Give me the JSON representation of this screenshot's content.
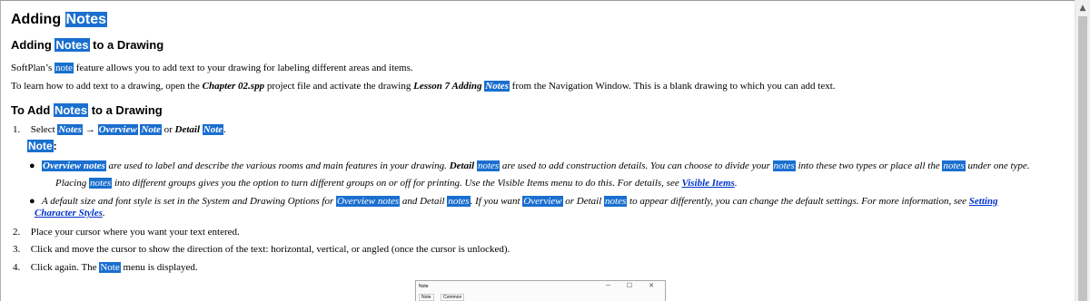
{
  "page": {
    "title_a": "Adding",
    "title_b": "Notes",
    "h2_a": "Adding",
    "h2_b": "Notes",
    "h2_c": "to a Drawing",
    "intro1_a": "SoftPlan’s",
    "intro1_b": "note",
    "intro1_c": "feature allows you to add text to your drawing for labeling different areas and items.",
    "intro2_a": "To learn how to add text to a drawing, open the",
    "intro2_b": "Chapter 02.spp",
    "intro2_c": "project file and activate the drawing",
    "intro2_d": "Lesson 7 Adding",
    "intro2_e": "Notes",
    "intro2_f": "from the Navigation Window. This is a blank drawing to which you can add text.",
    "h3_a": "To Add",
    "h3_b": "Notes",
    "h3_c": "to a Drawing",
    "step1_num": "1.",
    "step1_a": "Select",
    "step1_b": "Notes",
    "step1_arrow": "→",
    "step1_c": "Overview",
    "step1_d": "Note",
    "step1_e": "or",
    "step1_f": "Detail",
    "step1_g": "Note",
    "step1_h": ".",
    "note_label_a": "Note",
    "note_label_b": ":",
    "b1_a": "Overview notes",
    "b1_b": "are used to label and describe the various rooms and main features in your drawing.",
    "b1_c": "Detail",
    "b1_d": "notes",
    "b1_e": "are used to add construction details. You can choose to divide your",
    "b1_f": "notes",
    "b1_g": "into these two types or place all the",
    "b1_h": "notes",
    "b1_i": "under one type.",
    "b1_j": "Placing",
    "b1_k": "notes",
    "b1_l": "into different groups gives you the option to turn different groups on or off for printing. Use the Visible Items menu to do this. For details, see",
    "b1_m": "Visible Items",
    "b1_n": ".",
    "b2_a": "A default size and font style is set in the System and Drawing Options for",
    "b2_b": "Overview notes",
    "b2_c": "and Detail",
    "b2_d": "notes",
    "b2_e": ". If you want",
    "b2_f": "Overview",
    "b2_g": "or Detail",
    "b2_h": "notes",
    "b2_i": "to appear differently, you can change the default settings. For more information, see",
    "b2_j": "Setting",
    "b2_k": "Character Styles",
    "b2_l": ".",
    "step2_num": "2.",
    "step2": "Place your cursor where you want your text entered.",
    "step3_num": "3.",
    "step3": "Click and move the cursor to show the direction of the text: horizontal, vertical, or angled (once the cursor is unlocked).",
    "step4_num": "4.",
    "step4_a": "Click again. The",
    "step4_b": "Note",
    "step4_c": "menu is displayed."
  },
  "dialog": {
    "title": "Note",
    "controls": "─ ☐ ✕",
    "tab1": "Note",
    "tab2": "Common"
  },
  "icons": {
    "scroll_up": "scroll-up-arrow-icon"
  },
  "colors": {
    "highlight": "#1a6fcf",
    "link": "#0033cc"
  }
}
